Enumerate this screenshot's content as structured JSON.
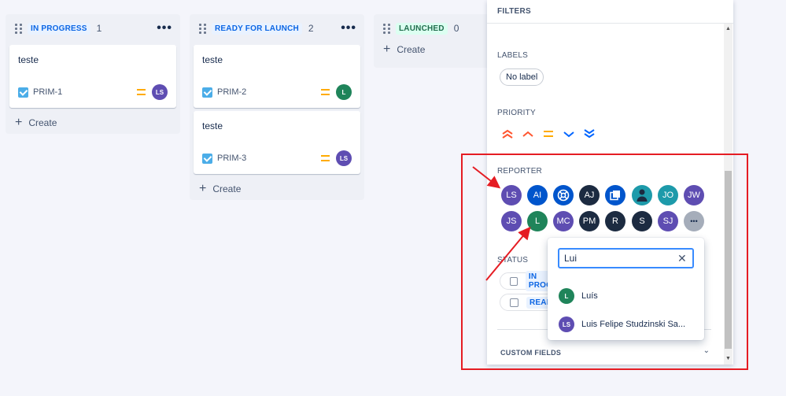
{
  "colors": {
    "purple": "#5e4db2",
    "blue": "#0055cc",
    "green": "#1f845a",
    "navy": "#1c2b41",
    "teal": "#1d9aaa",
    "gray": "#a5adba",
    "annotation": "#e51c23"
  },
  "columns": [
    {
      "status": "IN PROGRESS",
      "count": "1",
      "more": "•••",
      "create": "Create",
      "cards": [
        {
          "title": "teste",
          "key": "PRIM-1",
          "assignee": "LS"
        }
      ]
    },
    {
      "status": "READY FOR LAUNCH",
      "count": "2",
      "more": "•••",
      "create": "Create",
      "cards": [
        {
          "title": "teste",
          "key": "PRIM-2",
          "assignee": "L"
        },
        {
          "title": "teste",
          "key": "PRIM-3",
          "assignee": "LS"
        }
      ]
    },
    {
      "status": "LAUNCHED",
      "count": "0",
      "create": "Create",
      "cards": []
    }
  ],
  "filters": {
    "header": "FILTERS",
    "labels_title": "LABELS",
    "label_chip": "No label",
    "priority_title": "PRIORITY",
    "priority_icons": [
      "highest-icon",
      "high-icon",
      "medium-icon",
      "low-icon",
      "lowest-icon"
    ],
    "reporter_title": "REPORTER",
    "reporters": [
      "LS",
      "AI",
      "",
      "AJ",
      "",
      "",
      "JO",
      "JW",
      "JS",
      "L",
      "MC",
      "PM",
      "R",
      "S",
      "SJ",
      "•••"
    ],
    "status_title": "STATUS",
    "status_options": [
      "IN PROG",
      "READY"
    ],
    "custom_fields": "CUSTOM FIELDS"
  },
  "dropdown": {
    "search_value": "Lui",
    "clear": "✕",
    "results": [
      {
        "initials": "L",
        "name": "Luís"
      },
      {
        "initials": "LS",
        "name": "Luis Felipe Studzinski Sa..."
      }
    ]
  }
}
